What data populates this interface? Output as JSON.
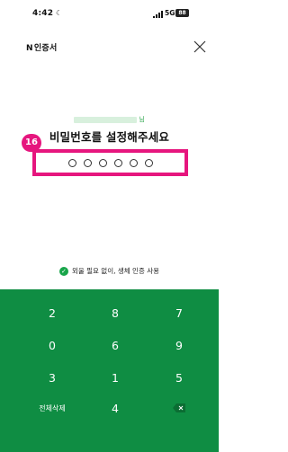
{
  "status_bar": {
    "time": "4:42",
    "time_icon": "do-not-disturb-icon",
    "network": "5G",
    "battery": "88"
  },
  "app_bar": {
    "brand_n": "N",
    "brand_label": "인증서",
    "close_icon": "close-icon"
  },
  "header": {
    "name_suffix": "님",
    "title": "비밀번호를 설정해주세요"
  },
  "annotation": {
    "badge": "16"
  },
  "pin": {
    "digits_entered": 0,
    "length": 6
  },
  "biometric": {
    "checked": true,
    "label": "외울 필요 없이, 생체 인증 사용"
  },
  "keypad": {
    "rows": [
      [
        "2",
        "8",
        "7"
      ],
      [
        "0",
        "6",
        "9"
      ],
      [
        "3",
        "1",
        "5"
      ]
    ],
    "bottom": {
      "clear_all": "전체삭제",
      "digit": "4",
      "backspace_icon": "backspace-icon"
    }
  },
  "colors": {
    "keypad_bg": "#0f8d43",
    "accent_pink": "#e6167e",
    "check_green": "#18a54a"
  }
}
